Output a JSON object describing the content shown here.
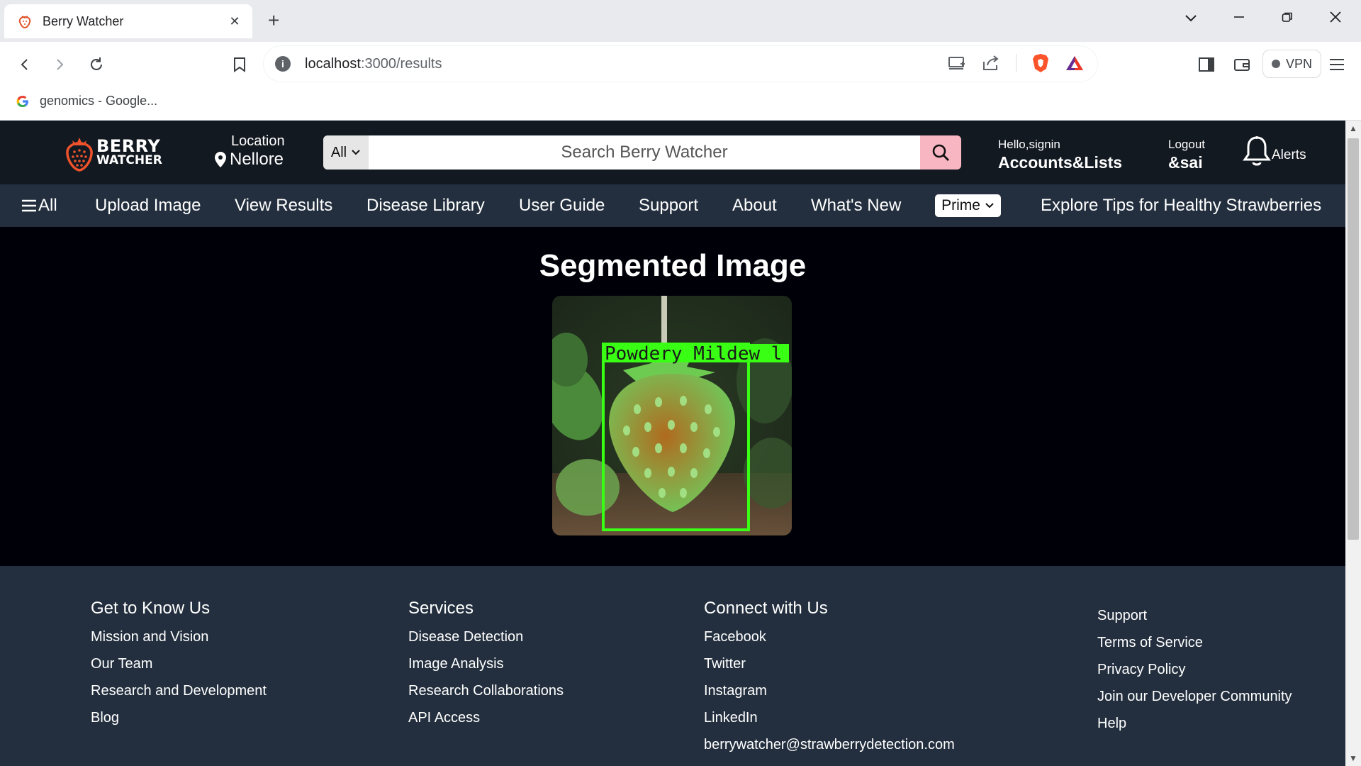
{
  "browser": {
    "tab_title": "Berry Watcher",
    "url_host": "localhost",
    "url_path": ":3000/results",
    "bookmark_label": "genomics - Google...",
    "vpn_label": "VPN",
    "new_tab_symbol": "+",
    "tab_close_symbol": "✕"
  },
  "header": {
    "logo_line1": "BERRY",
    "logo_line2": "WATCHER",
    "location_label": "Location",
    "location_value": "Nellore",
    "search_category": "All",
    "search_placeholder": "Search Berry Watcher",
    "account_greeting": "Hello,signin",
    "account_label": "Accounts&Lists",
    "logout_label": "Logout",
    "logout_user": "&sai",
    "alerts_label": "Alerts"
  },
  "nav": {
    "all_label": "All",
    "items": [
      "Upload Image",
      "View Results",
      "Disease Library",
      "User Guide",
      "Support",
      "About",
      "What's New"
    ],
    "prime_label": "Prime",
    "tips_label": "Explore Tips for Healthy Strawberries"
  },
  "main": {
    "title": "Segmented Image",
    "detection_label": "Powdery Mildew l"
  },
  "footer": {
    "col1": {
      "heading": "Get to Know Us",
      "links": [
        "Mission and Vision",
        "Our Team",
        "Research and Development",
        "Blog"
      ]
    },
    "col2": {
      "heading": "Services",
      "links": [
        "Disease Detection",
        "Image Analysis",
        "Research Collaborations",
        "API Access"
      ]
    },
    "col3": {
      "heading": "Connect with Us",
      "links": [
        "Facebook",
        "Twitter",
        "Instagram",
        "LinkedIn",
        "berrywatcher@strawberrydetection.com"
      ]
    },
    "col4": {
      "links": [
        "Support",
        "Terms of Service",
        "Privacy Policy",
        "Join our Developer Community",
        "Help"
      ]
    }
  },
  "colors": {
    "header_bg": "#131921",
    "nav_bg": "#232f3e",
    "footer_bg": "#232f3e",
    "main_bg": "#000008",
    "search_button": "#f7b6c2",
    "detection_box": "#39ff14"
  },
  "icons": [
    "strawberry-logo-icon",
    "location-pin-icon",
    "search-icon",
    "bell-icon",
    "hamburger-icon",
    "chevron-down-icon",
    "back-icon",
    "forward-icon",
    "reload-icon",
    "bookmark-icon",
    "info-icon",
    "cast-icon",
    "share-icon",
    "brave-shield-icon",
    "brave-rewards-icon",
    "sidebar-icon",
    "wallet-icon",
    "menu-icon",
    "google-icon"
  ]
}
